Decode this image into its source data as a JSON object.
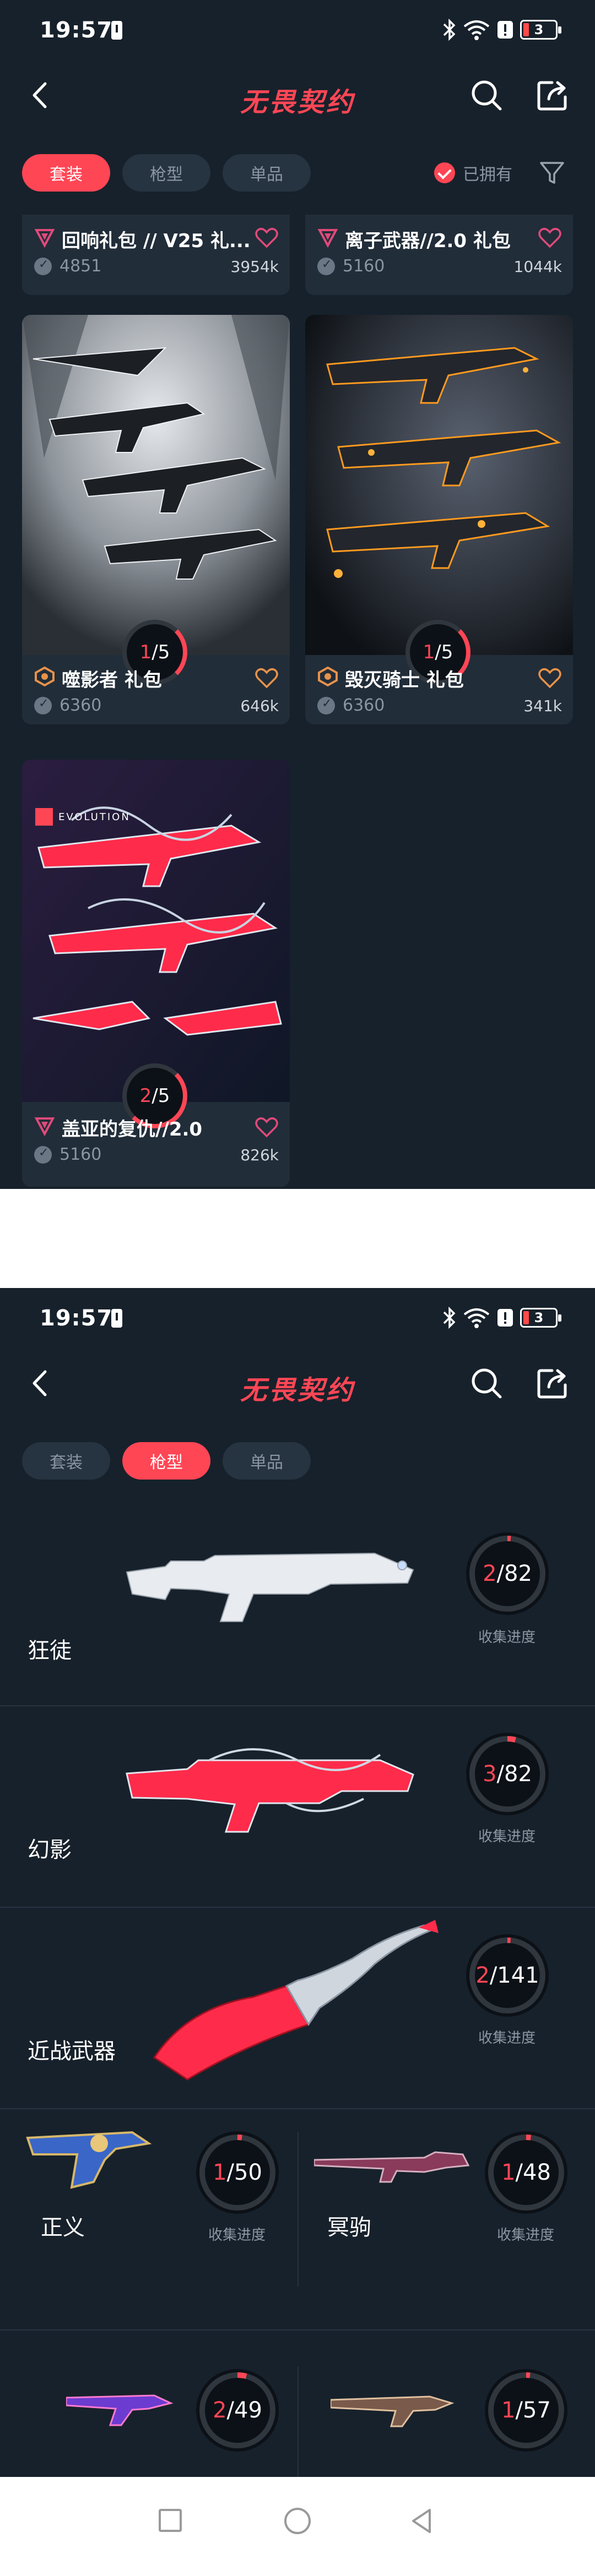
{
  "status": {
    "time": "19:57",
    "battery": "3"
  },
  "app": {
    "brand": "无畏契约"
  },
  "tabs": [
    {
      "label": "套装"
    },
    {
      "label": "枪型"
    },
    {
      "label": "单品"
    }
  ],
  "filter": {
    "owned_label": "已拥有"
  },
  "bundles": [
    {
      "title": "回响礼包 // V25 礼...",
      "vp": "4851",
      "likes": "3954k"
    },
    {
      "title": "离子武器//2.0 礼包",
      "vp": "5160",
      "likes": "1044k"
    },
    {
      "title": "噬影者 礼包",
      "vp": "6360",
      "likes": "646k",
      "owned": "1",
      "total": "/5"
    },
    {
      "title": "毁灭骑士 礼包",
      "vp": "6360",
      "likes": "341k",
      "owned": "1",
      "total": "/5"
    },
    {
      "title": "盖亚的复仇//2.0",
      "vp": "5160",
      "likes": "826k",
      "owned": "2",
      "total": "/5",
      "badge_text": "EVOLUTION"
    }
  ],
  "weapons": {
    "progress_label": "收集进度",
    "rows": [
      {
        "name": "狂徒",
        "owned": "2",
        "total": "/82"
      },
      {
        "name": "幻影",
        "owned": "3",
        "total": "/82"
      },
      {
        "name": "近战武器",
        "owned": "2",
        "total": "/141"
      }
    ],
    "pairs": [
      {
        "name": "正义",
        "owned": "1",
        "total": "/50"
      },
      {
        "name": "冥驹",
        "owned": "1",
        "total": "/48"
      },
      {
        "name": "",
        "owned": "2",
        "total": "/49"
      },
      {
        "name": "",
        "owned": "1",
        "total": "/57"
      }
    ]
  },
  "colors": {
    "accent": "#ff4655",
    "background": "#17212b",
    "card": "#212d39"
  }
}
